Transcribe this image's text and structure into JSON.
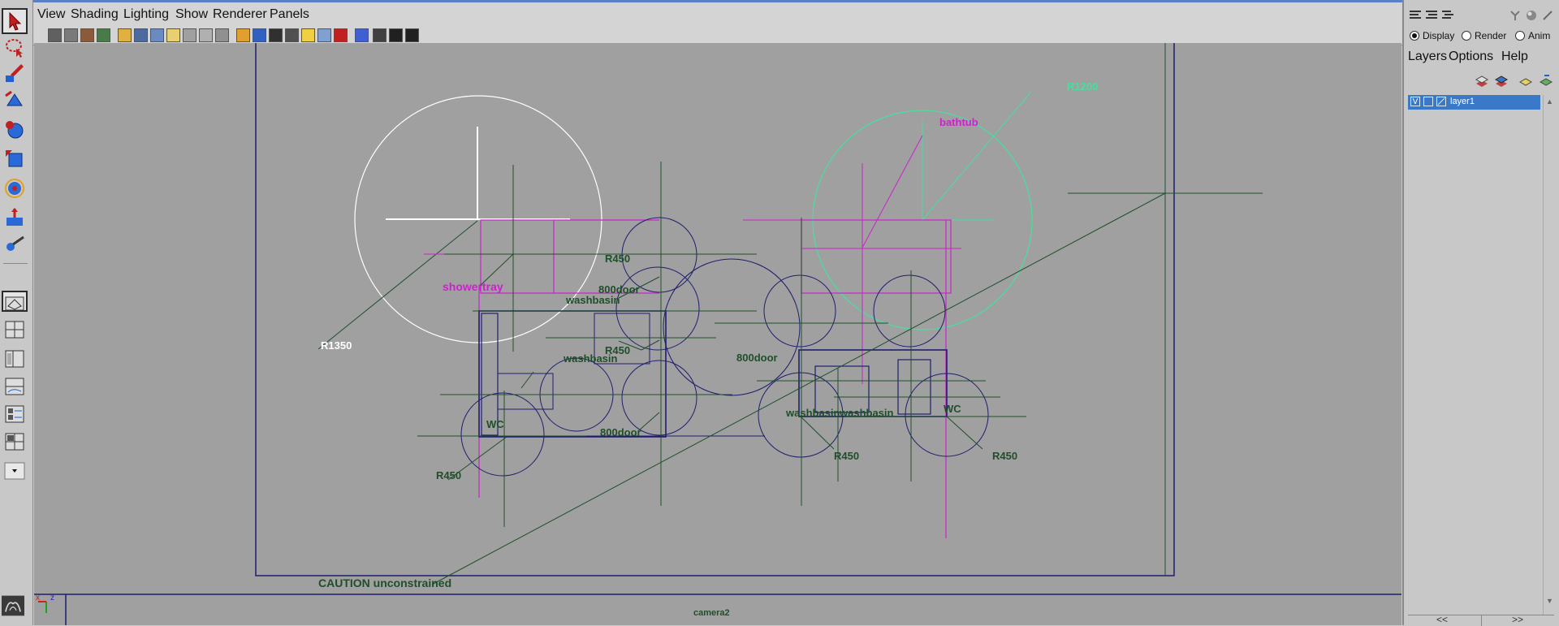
{
  "menubar": {
    "items": [
      "View",
      "Shading",
      "Lighting",
      "Show",
      "Renderer",
      "Panels"
    ]
  },
  "toolbox": {
    "tools": [
      "select-tool-icon",
      "lasso-tool-icon",
      "paint-select-icon",
      "move-tool-icon",
      "rotate-tool-icon",
      "scale-tool-icon",
      "universal-manipulator-icon",
      "soft-mod-icon",
      "show-manipulator-icon"
    ],
    "layouts": [
      "single-pane-layout-icon",
      "four-pane-layout-icon",
      "side-by-side-layout-icon",
      "persp-outliner-layout-icon",
      "persp-graph-layout-icon",
      "hypershade-layout-icon",
      "persp-graph-hypershade-icon"
    ]
  },
  "viewport": {
    "camera_label": "camera2",
    "status_text": "CAUTION unconstrained",
    "axis_x": "x",
    "axis_z": "z",
    "annotations": {
      "shower": "showertray",
      "r1350": "R1350",
      "bathtub": "bathtub",
      "r1200": "R1200",
      "r450_a": "R450",
      "door_a": "800door",
      "washbasin_a": "washbasin",
      "r450_b": "R450",
      "washbasin_b": "washbasin",
      "door_b": "800door",
      "door_c": "800door",
      "wc_a": "WC",
      "r450_c": "R450",
      "washbasin_c": "washbasin",
      "washbasin_d": "washbasin",
      "wc_b": "WC",
      "r450_d": "R450",
      "r450_e": "R450"
    }
  },
  "right_panel": {
    "tabs": {
      "display": "Display",
      "render": "Render",
      "anim": "Anim"
    },
    "selected_tab": "Display",
    "menu": [
      "Layers",
      "Options",
      "Help"
    ],
    "layer": {
      "visible_flag": "V",
      "name": "layer1"
    },
    "scroll_left": "<<",
    "scroll_right": ">>"
  },
  "colors": {
    "viewport_bg": "#a0a0a0",
    "dark_green": "#1f4f2a",
    "magenta": "#cc22cc",
    "navy": "#1e1e6e",
    "mint": "#45e0a0",
    "selection_blue": "#3a78c8"
  }
}
